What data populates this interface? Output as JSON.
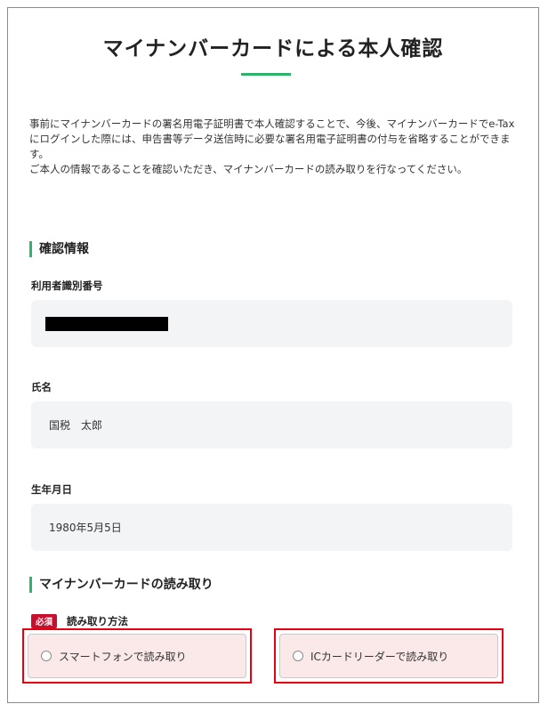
{
  "page": {
    "title": "マイナンバーカードによる本人確認",
    "intro": [
      "事前にマイナンバーカードの署名用電子証明書で本人確認することで、今後、マイナンバーカードでe-Taxにログインした際には、申告書等データ送信時に必要な署名用電子証明書の付与を省略することができます。",
      "ご本人の情報であることを確認いただき、マイナンバーカードの読み取りを行なってください。"
    ]
  },
  "confirmation": {
    "heading": "確認情報",
    "fields": [
      {
        "label": "利用者識別番号",
        "value": ""
      },
      {
        "label": "氏名",
        "value": "国税　太郎"
      },
      {
        "label": "生年月日",
        "value": "1980年5月5日"
      }
    ]
  },
  "card_reading": {
    "heading": "マイナンバーカードの読み取り",
    "required_badge": "必須",
    "method_label": "読み取り方法",
    "options": [
      {
        "label": "スマートフォンで読み取り",
        "selected": false
      },
      {
        "label": "ICカードリーダーで読み取り",
        "selected": false
      }
    ]
  },
  "colors": {
    "accent": "#2fb36b",
    "required": "#c8102e",
    "highlight": "#e60012",
    "option_bg": "#fbe9ea"
  }
}
